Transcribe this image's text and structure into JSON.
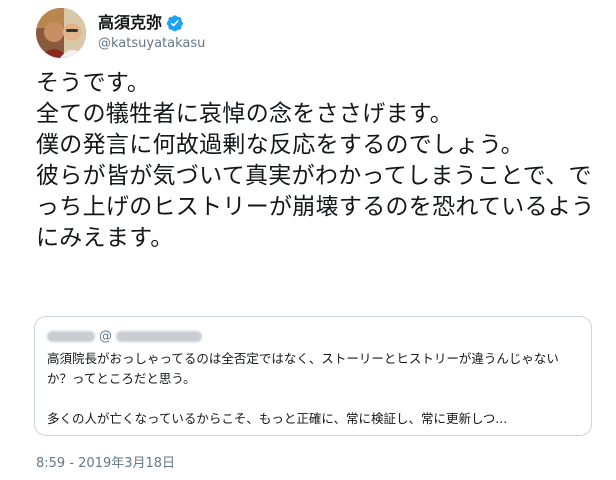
{
  "author": {
    "display_name": "高須克弥",
    "handle": "@katsuyatakasu",
    "verified": true
  },
  "tweet": {
    "text": "そうです。\n全ての犠牲者に哀悼の念をささげます。\n僕の発言に何故過剰な反応をするのでしょう。\n彼らが皆が気づいて真実がわかってしまうことで、でっち上げのヒストリーが崩壊するのを恐れているようにみえます。"
  },
  "quoted_tweet": {
    "at_sign": "@",
    "text": "高須院長がおっしゃってるのは全否定ではなく、ストーリーとヒストリーが違うんじゃないか？ってところだと思う。\n\n多くの人が亡くなっているからこそ、もっと正確に、常に検証し、常に更新しつ..."
  },
  "timestamp": "8:59 - 2019年3月18日",
  "colors": {
    "text_primary": "#14171a",
    "text_secondary": "#657786",
    "verified_blue": "#1da1f2",
    "border": "#ccd6dd"
  },
  "icons": {
    "verified": "verified-badge-icon",
    "avatar": "profile-photo"
  }
}
